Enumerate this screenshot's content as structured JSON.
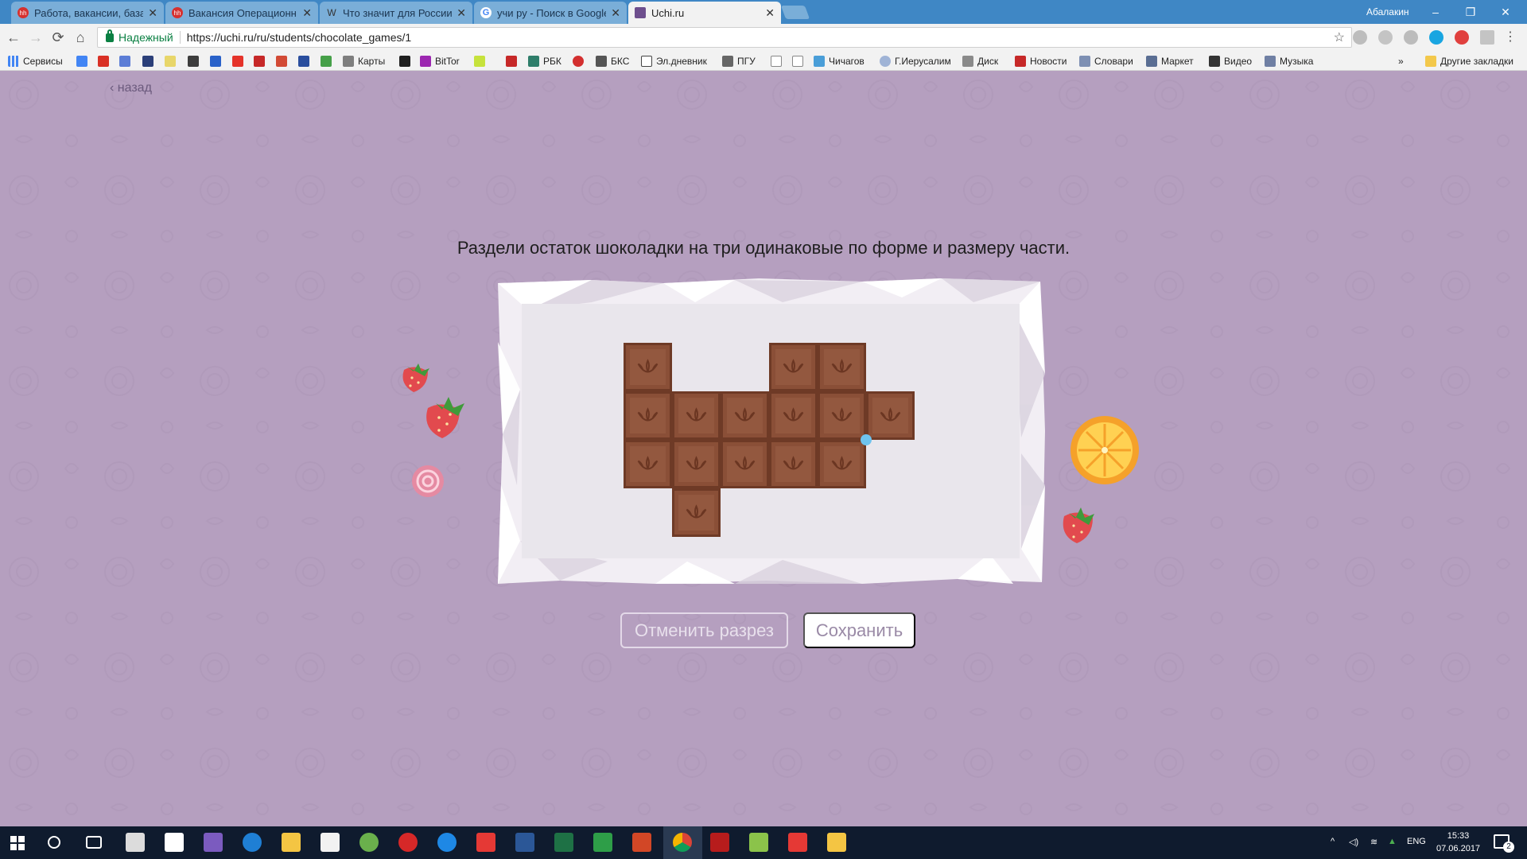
{
  "browser": {
    "tabs": [
      {
        "title": "Работа, вакансии, база",
        "favicon": "hh"
      },
      {
        "title": "Вакансия Операционн",
        "favicon": "hh"
      },
      {
        "title": "Что значит для России",
        "favicon": "W"
      },
      {
        "title": "учи ру - Поиск в Google",
        "favicon": "G"
      },
      {
        "title": "Uchi.ru",
        "favicon": ""
      }
    ],
    "user": "Абалакин",
    "window": {
      "minimize": "–",
      "restore": "❐",
      "close": "✕"
    },
    "nav": {
      "back": "←",
      "forward": "→",
      "reload": "⟳",
      "home": "⌂"
    },
    "secure_label": "Надежный",
    "url": "https://uchi.ru/ru/students/chocolate_games/1",
    "bookmarks": [
      "Сервисы",
      "Карты",
      "BitTor",
      "РБК",
      "БКС",
      "Эл.дневник",
      "ПГУ",
      "Чичагов",
      "Г.Иерусалим",
      "Диск",
      "Новости",
      "Словари",
      "Маркет",
      "Видео",
      "Музыка"
    ],
    "bookmark_overflow": "»",
    "other_bookmarks": "Другие закладки"
  },
  "page": {
    "back_label": "назад",
    "task_text": "Раздели остаток шоколадки на три одинаковые по форме и размеру части.",
    "cancel_button": "Отменить разрез",
    "save_button": "Сохранить"
  },
  "chocolate": {
    "cells": [
      [
        0,
        0
      ],
      [
        3,
        0
      ],
      [
        4,
        0
      ],
      [
        0,
        1
      ],
      [
        1,
        1
      ],
      [
        2,
        1
      ],
      [
        3,
        1
      ],
      [
        4,
        1
      ],
      [
        5,
        1
      ],
      [
        0,
        2
      ],
      [
        1,
        2
      ],
      [
        2,
        2
      ],
      [
        3,
        2
      ],
      [
        4,
        2
      ],
      [
        1,
        3
      ]
    ],
    "color": "#8a4f37",
    "cut_point": [
      5,
      2
    ]
  },
  "taskbar": {
    "language": "ENG",
    "time": "15:33",
    "date": "07.06.2017",
    "notifications": "2"
  },
  "colors": {
    "titlebar": "#3f87c5",
    "page_background": "#b59fbf",
    "chocolate": "#8a4f37",
    "cut_dot": "#6ec3ee",
    "taskbar": "#0f1b2e"
  }
}
